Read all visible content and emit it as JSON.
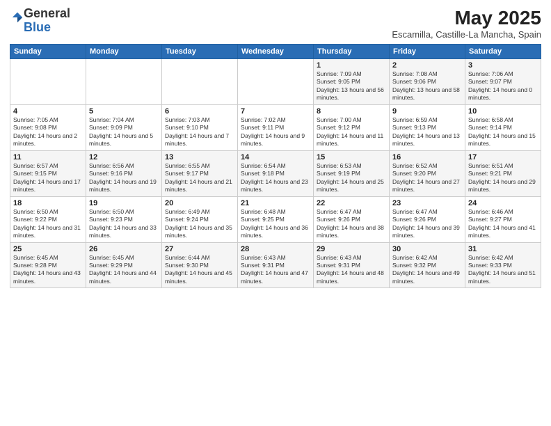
{
  "header": {
    "logo_general": "General",
    "logo_blue": "Blue",
    "title": "May 2025",
    "location": "Escamilla, Castille-La Mancha, Spain"
  },
  "weekdays": [
    "Sunday",
    "Monday",
    "Tuesday",
    "Wednesday",
    "Thursday",
    "Friday",
    "Saturday"
  ],
  "weeks": [
    [
      {
        "day": "",
        "info": ""
      },
      {
        "day": "",
        "info": ""
      },
      {
        "day": "",
        "info": ""
      },
      {
        "day": "",
        "info": ""
      },
      {
        "day": "1",
        "info": "Sunrise: 7:09 AM\nSunset: 9:05 PM\nDaylight: 13 hours and 56 minutes."
      },
      {
        "day": "2",
        "info": "Sunrise: 7:08 AM\nSunset: 9:06 PM\nDaylight: 13 hours and 58 minutes."
      },
      {
        "day": "3",
        "info": "Sunrise: 7:06 AM\nSunset: 9:07 PM\nDaylight: 14 hours and 0 minutes."
      }
    ],
    [
      {
        "day": "4",
        "info": "Sunrise: 7:05 AM\nSunset: 9:08 PM\nDaylight: 14 hours and 2 minutes."
      },
      {
        "day": "5",
        "info": "Sunrise: 7:04 AM\nSunset: 9:09 PM\nDaylight: 14 hours and 5 minutes."
      },
      {
        "day": "6",
        "info": "Sunrise: 7:03 AM\nSunset: 9:10 PM\nDaylight: 14 hours and 7 minutes."
      },
      {
        "day": "7",
        "info": "Sunrise: 7:02 AM\nSunset: 9:11 PM\nDaylight: 14 hours and 9 minutes."
      },
      {
        "day": "8",
        "info": "Sunrise: 7:00 AM\nSunset: 9:12 PM\nDaylight: 14 hours and 11 minutes."
      },
      {
        "day": "9",
        "info": "Sunrise: 6:59 AM\nSunset: 9:13 PM\nDaylight: 14 hours and 13 minutes."
      },
      {
        "day": "10",
        "info": "Sunrise: 6:58 AM\nSunset: 9:14 PM\nDaylight: 14 hours and 15 minutes."
      }
    ],
    [
      {
        "day": "11",
        "info": "Sunrise: 6:57 AM\nSunset: 9:15 PM\nDaylight: 14 hours and 17 minutes."
      },
      {
        "day": "12",
        "info": "Sunrise: 6:56 AM\nSunset: 9:16 PM\nDaylight: 14 hours and 19 minutes."
      },
      {
        "day": "13",
        "info": "Sunrise: 6:55 AM\nSunset: 9:17 PM\nDaylight: 14 hours and 21 minutes."
      },
      {
        "day": "14",
        "info": "Sunrise: 6:54 AM\nSunset: 9:18 PM\nDaylight: 14 hours and 23 minutes."
      },
      {
        "day": "15",
        "info": "Sunrise: 6:53 AM\nSunset: 9:19 PM\nDaylight: 14 hours and 25 minutes."
      },
      {
        "day": "16",
        "info": "Sunrise: 6:52 AM\nSunset: 9:20 PM\nDaylight: 14 hours and 27 minutes."
      },
      {
        "day": "17",
        "info": "Sunrise: 6:51 AM\nSunset: 9:21 PM\nDaylight: 14 hours and 29 minutes."
      }
    ],
    [
      {
        "day": "18",
        "info": "Sunrise: 6:50 AM\nSunset: 9:22 PM\nDaylight: 14 hours and 31 minutes."
      },
      {
        "day": "19",
        "info": "Sunrise: 6:50 AM\nSunset: 9:23 PM\nDaylight: 14 hours and 33 minutes."
      },
      {
        "day": "20",
        "info": "Sunrise: 6:49 AM\nSunset: 9:24 PM\nDaylight: 14 hours and 35 minutes."
      },
      {
        "day": "21",
        "info": "Sunrise: 6:48 AM\nSunset: 9:25 PM\nDaylight: 14 hours and 36 minutes."
      },
      {
        "day": "22",
        "info": "Sunrise: 6:47 AM\nSunset: 9:26 PM\nDaylight: 14 hours and 38 minutes."
      },
      {
        "day": "23",
        "info": "Sunrise: 6:47 AM\nSunset: 9:26 PM\nDaylight: 14 hours and 39 minutes."
      },
      {
        "day": "24",
        "info": "Sunrise: 6:46 AM\nSunset: 9:27 PM\nDaylight: 14 hours and 41 minutes."
      }
    ],
    [
      {
        "day": "25",
        "info": "Sunrise: 6:45 AM\nSunset: 9:28 PM\nDaylight: 14 hours and 43 minutes."
      },
      {
        "day": "26",
        "info": "Sunrise: 6:45 AM\nSunset: 9:29 PM\nDaylight: 14 hours and 44 minutes."
      },
      {
        "day": "27",
        "info": "Sunrise: 6:44 AM\nSunset: 9:30 PM\nDaylight: 14 hours and 45 minutes."
      },
      {
        "day": "28",
        "info": "Sunrise: 6:43 AM\nSunset: 9:31 PM\nDaylight: 14 hours and 47 minutes."
      },
      {
        "day": "29",
        "info": "Sunrise: 6:43 AM\nSunset: 9:31 PM\nDaylight: 14 hours and 48 minutes."
      },
      {
        "day": "30",
        "info": "Sunrise: 6:42 AM\nSunset: 9:32 PM\nDaylight: 14 hours and 49 minutes."
      },
      {
        "day": "31",
        "info": "Sunrise: 6:42 AM\nSunset: 9:33 PM\nDaylight: 14 hours and 51 minutes."
      }
    ]
  ]
}
